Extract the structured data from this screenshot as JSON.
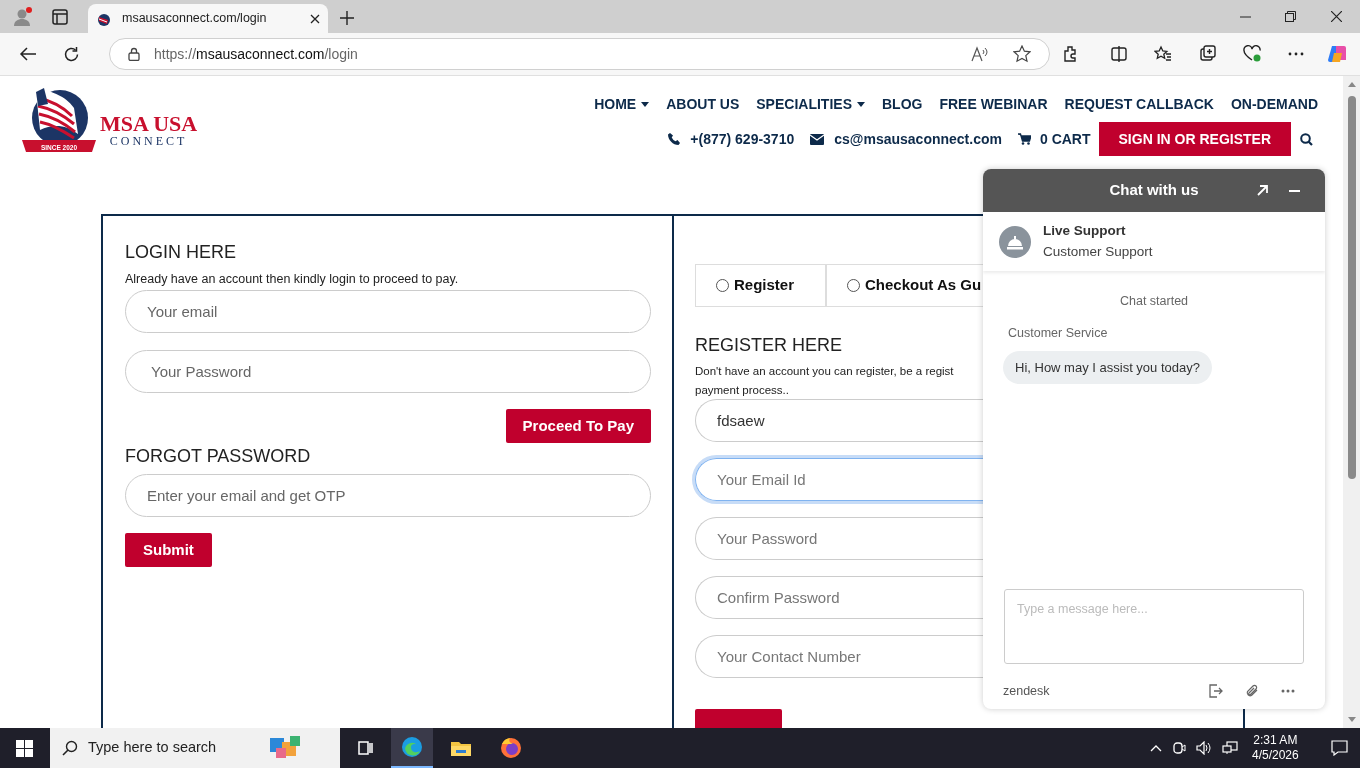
{
  "browser": {
    "tab": {
      "title": "msausaconnect.com/login",
      "selected": true
    },
    "address": {
      "scheme": "https://",
      "host": "msausaconnect.com",
      "path": "/login"
    }
  },
  "logo": {
    "title": "MSA USA",
    "subtitle": "CONNECT",
    "ribbon": "SINCE 2020"
  },
  "nav": [
    {
      "label": "HOME",
      "dropdown": true
    },
    {
      "label": "ABOUT US",
      "dropdown": false
    },
    {
      "label": "SPECIALITIES",
      "dropdown": true
    },
    {
      "label": "BLOG",
      "dropdown": false
    },
    {
      "label": "FREE WEBINAR",
      "dropdown": false
    },
    {
      "label": "REQUEST CALLBACK",
      "dropdown": false
    },
    {
      "label": "ON-DEMAND",
      "dropdown": false
    }
  ],
  "contact": {
    "phone": "+(877) 629-3710",
    "email": "cs@msausaconnect.com",
    "cart": "0 CART",
    "signin": "SIGN IN OR REGISTER"
  },
  "login": {
    "heading": "LOGIN HERE",
    "note": "Already have an account then kindly login to proceed to pay.",
    "fields": [
      {
        "placeholder": "Your email"
      },
      {
        "placeholder": "Your Password"
      }
    ],
    "button": "Proceed To Pay",
    "forgot_heading": "FORGOT PASSWORD",
    "forgot_field": {
      "placeholder": "Enter your email and get OTP"
    },
    "submit": "Submit"
  },
  "register": {
    "options": [
      {
        "label": "Register",
        "selected": false
      },
      {
        "label": "Checkout As Gu",
        "selected": false
      }
    ],
    "heading": "REGISTER HERE",
    "description_lines": [
      "Don't have an account you can register, be a regist",
      "payment process.."
    ],
    "fields": [
      {
        "value": "fdsaew",
        "focused": false
      },
      {
        "placeholder": "Your Email Id",
        "focused": true
      },
      {
        "placeholder": "Your Password",
        "focused": false
      },
      {
        "placeholder": "Confirm Password",
        "focused": false
      },
      {
        "placeholder": "Your Contact Number",
        "focused": false
      }
    ],
    "submit_button": {
      "kind": "button"
    }
  },
  "chat": {
    "title": "Chat with us",
    "agent_name": "Live Support",
    "agent_role": "Customer Support",
    "status": "Chat started",
    "sender": "Customer Service",
    "message": "Hi, How may I assist you today?",
    "placeholder": "Type a message here...",
    "brand": "zendesk"
  },
  "taskbar": {
    "search_placeholder": "Type here to search",
    "apps": [
      {
        "kind": "widgets",
        "selected": false
      },
      {
        "kind": "taskview",
        "selected": false
      },
      {
        "kind": "edge",
        "selected": true
      },
      {
        "kind": "explorer",
        "selected": false
      },
      {
        "kind": "firefox",
        "selected": false
      }
    ],
    "time": "2:31 AM",
    "date": "4/5/2026"
  }
}
